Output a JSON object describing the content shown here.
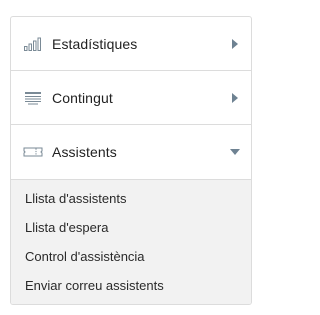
{
  "colors": {
    "border": "#dcdcdc",
    "icon": "#7a8a96",
    "arrow": "#6e8292",
    "submenu_background": "#f2f2f2"
  },
  "sections": [
    {
      "label": "Estadístiques",
      "icon": "bar-chart-icon",
      "state": "collapsed"
    },
    {
      "label": "Contingut",
      "icon": "list-icon",
      "state": "collapsed"
    },
    {
      "label": "Assistents",
      "icon": "ticket-icon",
      "state": "expanded"
    }
  ],
  "submenu": {
    "items": [
      "Llista d'assistents",
      "Llista d'espera",
      "Control d'assistència",
      "Enviar correu assistents"
    ]
  }
}
